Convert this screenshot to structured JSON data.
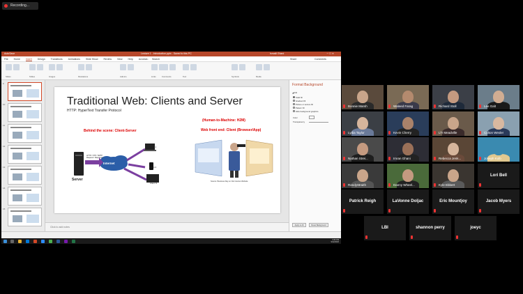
{
  "recording": {
    "label": "Recording..."
  },
  "powerpoint": {
    "title": "Lecture 1 - Introduction.pptx - Saved to this PC",
    "user": "Ismaili Ghani",
    "search_placeholder": "Search",
    "menu_tabs": [
      "File",
      "Home",
      "Insert",
      "Design",
      "Transitions",
      "Animations",
      "Slide Show",
      "Review",
      "View",
      "Help",
      "Acrobat"
    ],
    "active_tab": "Insert",
    "share_label": "Share",
    "comments_label": "Comments",
    "ribbon_groups": [
      "Slides",
      "Tables",
      "Images",
      "Illustrations",
      "Add-ins",
      "Links",
      "Comments",
      "Text",
      "Symbols",
      "Media"
    ],
    "slide_numbers": [
      "9",
      "10",
      "11",
      "12",
      "13",
      "14",
      "15"
    ],
    "notes_placeholder": "Click to add notes",
    "format_pane": {
      "title": "Format Background",
      "section": "Fill",
      "options": [
        "Solid fill",
        "Gradient fill",
        "Picture or texture fill",
        "Pattern fill",
        "Hide background graphics"
      ],
      "color_label": "Color",
      "transparency_label": "Transparency",
      "apply_all": "Apply to All",
      "reset": "Reset Background"
    }
  },
  "slide": {
    "title": "Traditional Web: Clients and Server",
    "subtitle": "HTTP: HyperText Transfer Protocol",
    "behind_label": "Behind the scene: Client-Server",
    "h2m_label": "(Human-to-Machine: H2M)",
    "front_label": "Web front end: Client (Browser/App)",
    "server_label": "Server",
    "internet_label": "Internet",
    "client_labels": [
      "Client 1",
      "Client 2",
      "Client 3"
    ],
    "source_note": "Source: Business Day on Dot Internet Website"
  },
  "taskbar": {
    "time": "3:46 PM",
    "date": "9/12/2020"
  },
  "participants": [
    {
      "name": "Bonnie Marsh",
      "bg": "#5a4a3c",
      "skin": "#c9a58a",
      "shirt": "#2a2a2a"
    },
    {
      "name": "Waleed Farag",
      "bg": "#7a6a55",
      "skin": "#b48a6e",
      "shirt": "#3a3a4a"
    },
    {
      "name": "Richard Stoll",
      "bg": "#3b3f47",
      "skin": "#c49a80",
      "shirt": "#1e2a3a"
    },
    {
      "name": "Lee Galt",
      "bg": "#6b7d8a",
      "skin": "#d1ad92",
      "shirt": "#1a1a1a"
    },
    {
      "name": "Lydia Taylor",
      "bg": "#3b3f45",
      "skin": "#d6b59c",
      "shirt": "#6a7a9a"
    },
    {
      "name": "Kevin Cherry",
      "bg": "#2a3d5a",
      "skin": "#a9826a",
      "shirt": "#222"
    },
    {
      "name": "LTI Meadville",
      "bg": "#6a5a4a",
      "skin": "#c9a58a",
      "shirt": "#3a2a2a"
    },
    {
      "name": "Colton Wexler",
      "bg": "#8aa0b0",
      "skin": "#d8b8a0",
      "shirt": "#2a3a5a"
    },
    {
      "name": "Nathan Strei...",
      "bg": "#4a4a4a",
      "skin": "#c49a80",
      "shirt": "#1e1e1e"
    },
    {
      "name": "Imran Ghani",
      "bg": "#2d2d35",
      "skin": "#9a7058",
      "shirt": "#222"
    },
    {
      "name": "Rebecca Jenk...",
      "bg": "#5a4636",
      "skin": "#d6b59c",
      "shirt": "#6a4a3a"
    },
    {
      "name": "Joseph Kolb",
      "bg": "#3a8ab0",
      "skin": "#3a8ab0",
      "shirt": "#e0c890"
    },
    {
      "name": "RandyStraith",
      "bg": "#3a3a3a",
      "skin": "#c9a58a",
      "shirt": "#555"
    },
    {
      "name": "Danny Wheel...",
      "bg": "#4a6a3a",
      "skin": "#c49a80",
      "shirt": "#222"
    },
    {
      "name": "Kyle Ebbert",
      "bg": "#3a3530",
      "skin": "#c9a58a",
      "shirt": "#5a5a5a"
    },
    {
      "name": "Lori Bell"
    },
    {
      "name": "Patrick Reigh"
    },
    {
      "name": "LaVonne Doljac"
    },
    {
      "name": "Eric Mountjoy"
    },
    {
      "name": "Jacob Myers"
    },
    {
      "name": "LBI"
    },
    {
      "name": "shannon perry"
    },
    {
      "name": "joeyc"
    }
  ]
}
